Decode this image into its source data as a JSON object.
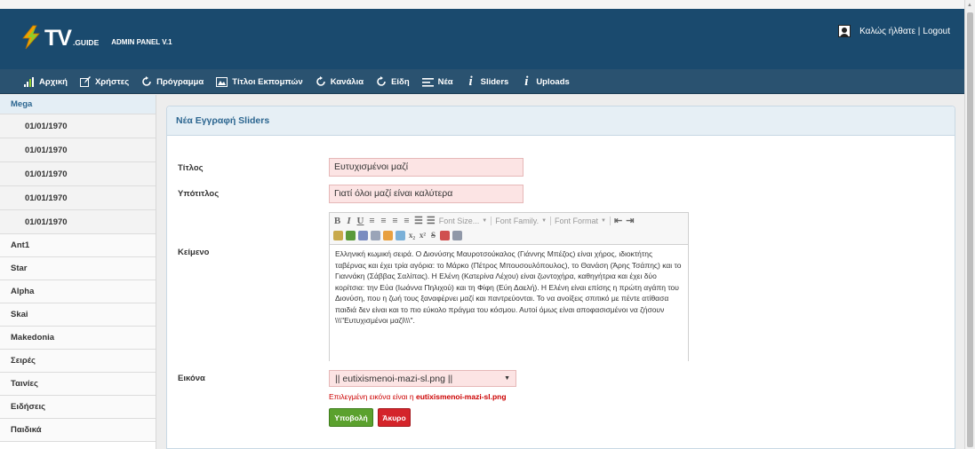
{
  "header": {
    "logo_tv": "TV",
    "logo_guide": ".GUIDE",
    "logo_admin": "ADMIN PANEL V.1",
    "welcome": "Καλώς ήλθατε |",
    "logout": "Logout"
  },
  "nav": [
    {
      "label": "Αρχική",
      "icon": "bar-chart-icon"
    },
    {
      "label": "Χρήστες",
      "icon": "edit-icon"
    },
    {
      "label": "Πρόγραμμα",
      "icon": "refresh-icon"
    },
    {
      "label": "Τίτλοι Εκπομπών",
      "icon": "image-icon"
    },
    {
      "label": "Κανάλια",
      "icon": "refresh-icon"
    },
    {
      "label": "Είδη",
      "icon": "refresh-icon"
    },
    {
      "label": "Νέα",
      "icon": "list-icon"
    },
    {
      "label": "Sliders",
      "icon": "info-icon"
    },
    {
      "label": "Uploads",
      "icon": "info-icon"
    }
  ],
  "sidebar": [
    {
      "label": "Mega",
      "type": "active"
    },
    {
      "label": "01/01/1970",
      "type": "sub"
    },
    {
      "label": "01/01/1970",
      "type": "sub"
    },
    {
      "label": "01/01/1970",
      "type": "sub"
    },
    {
      "label": "01/01/1970",
      "type": "sub"
    },
    {
      "label": "01/01/1970",
      "type": "sub"
    },
    {
      "label": "Ant1",
      "type": "item"
    },
    {
      "label": "Star",
      "type": "item"
    },
    {
      "label": "Alpha",
      "type": "item"
    },
    {
      "label": "Skai",
      "type": "item"
    },
    {
      "label": "Makedonia",
      "type": "item"
    },
    {
      "label": "Σειρές",
      "type": "item"
    },
    {
      "label": "Ταινίες",
      "type": "item"
    },
    {
      "label": "Ειδήσεις",
      "type": "item"
    },
    {
      "label": "Παιδικά",
      "type": "item"
    }
  ],
  "panel": {
    "title": "Νέα Εγγραφή Sliders"
  },
  "form": {
    "title_label": "Τίτλος",
    "title_value": "Ευτυχισμένοι μαζί",
    "subtitle_label": "Υπότιτλος",
    "subtitle_value": "Γιατί όλοι μαζί είναι καλύτερα",
    "text_label": "Κείμενο",
    "text_value": "Ελληνική κωμική σειρά. Ο Διονύσης Μαυροτσούκαλος (Γιάννης Μπέζος) είναι χήρος, ιδιοκτήτης ταβέρνας και έχει τρία αγόρια: το Μάρκο (Πέτρος Μπουσουλόπουλος), το Θανάση (Άρης Τσάπης) και το Γιαννάκη (Σάββας Σαλίπας). Η Ελένη (Κατερίνα Λέχου) είναι ζωντοχήρα, καθηγήτρια και έχει δύο κορίτσια: την Εύα (Ιωάννα Πηλιχού) και τη Φίφη (Εύη Δαελή). Η Ελένη είναι επίσης η πρώτη αγάπη του Διονύση, που η ζωή τους ξαναφέρνει μαζί και παντρεύονται. Το να ανοίξεις σπιτικό με πέντε ατίθασα παιδιά δεν είναι και το πιο εύκολο πράγμα του κόσμου. Αυτοί όμως είναι αποφασισμένοι να ζήσουν \\\\\\\"Ευτυχισμένοι μαζί\\\\\\\".",
    "image_label": "Εικόνα",
    "image_value": "|| eutixismenoi-mazi-sl.png ||",
    "image_note_prefix": "Επιλεγμένη εικόνα είναι η",
    "image_note_file": "eutixismenoi-mazi-sl.png",
    "submit_label": "Υποβολή",
    "cancel_label": "Άκυρο"
  },
  "editor": {
    "font_size": "Font Size...",
    "font_family": "Font Family.",
    "font_format": "Font Format"
  },
  "colors": {
    "header_bg": "#1a4a6e",
    "nav_bg": "#2a5270",
    "input_bg": "#fce4e4",
    "submit": "#5ba12e",
    "cancel": "#d4242a"
  }
}
